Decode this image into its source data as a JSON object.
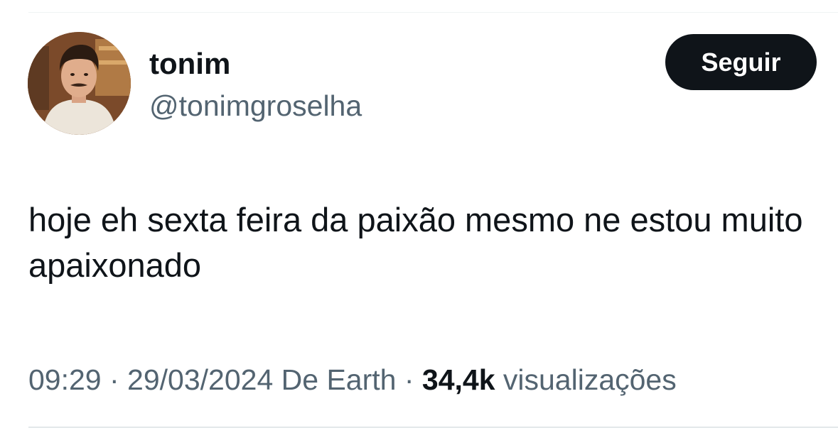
{
  "author": {
    "display_name": "tonim",
    "handle": "@tonimgroselha"
  },
  "follow_button": {
    "label": "Seguir"
  },
  "tweet": {
    "text": "hoje eh sexta feira da paixão mesmo ne estou muito apaixonado"
  },
  "meta": {
    "time": "09:29",
    "separator": " · ",
    "date": "29/03/2024",
    "source": " De Earth",
    "views_count": "34,4k",
    "views_label": " visualizações"
  },
  "colors": {
    "text_primary": "#0f1419",
    "text_secondary": "#536471",
    "button_bg": "#0f1419",
    "button_text": "#ffffff"
  }
}
